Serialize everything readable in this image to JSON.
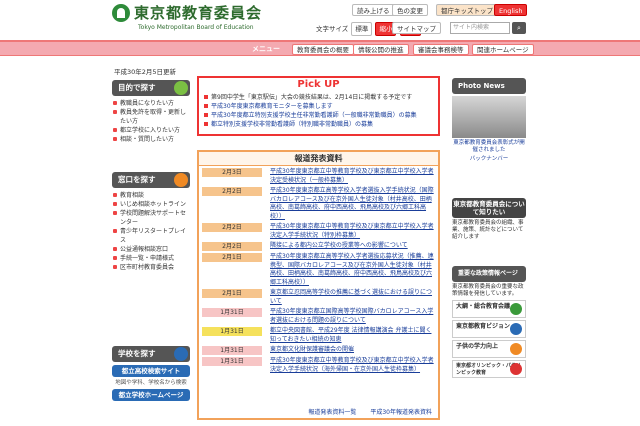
{
  "header": {
    "title": "東京都教育委員会",
    "subtitle": "Tokyo Metropolitan Board of Education",
    "read_aloud": "読み上げる",
    "color_change": "色の変更",
    "kids_top": "都庁キッズトップ",
    "english": "English",
    "text_size_label": "文字サイズ",
    "text_size_options": [
      "標準",
      "縮小",
      "拡大"
    ],
    "sitemap": "サイトマップ",
    "search_placeholder": "サイト内検索",
    "search_button": "検索"
  },
  "nav": {
    "menu_label": "メニュー",
    "items": [
      "教育委員会の概要",
      "情報公開の推進",
      "審議会事務検等",
      "関連ホームページ"
    ]
  },
  "date": "平成30年2月5日更新",
  "sidebar": {
    "purpose_head": "目的で探す",
    "purpose_items": [
      "教職員になりたい方",
      "教員免許を取得・更新したい方",
      "都立学校に入りたい方",
      "相談・質問したい方"
    ],
    "window_head": "窓口を探す",
    "window_items": [
      "教育相談",
      "いじめ相談ホットライン",
      "学校問題解決サポートセンター",
      "青少年リスタートプレイス",
      "公益通報相談窓口",
      "手続一覧・申請様式",
      "区市町村教育委員会"
    ],
    "school_head": "学校を探す",
    "school_banner1": "都立高校検索サイト",
    "school_note1": "地図や学科、学校名から検索",
    "school_banner2": "都立学校ホームページ"
  },
  "pickup": {
    "title": "Pick UP",
    "items": [
      "第9回中学生「東京駅伝」大会の競技結果は、2月14日に掲載する予定です",
      "平成30年度東京都教育モニターを募集します",
      "平成30年度都立特別支援学校主任非常勤看護師（一般職非常勤職員）の募集",
      "都立特別支援学校非常勤看護師（特別職非常勤職員）の募集"
    ]
  },
  "press": {
    "title": "報道発表資料",
    "rows": [
      {
        "date": "2月3日",
        "text": "平成30年度東京都立中等教育学校及び東京都立中学校入学者決定受検状況（一般枠募集）",
        "kind": "orange"
      },
      {
        "date": "2月2日",
        "text": "平成30年度東京都立高等学校入学者選抜入学手続状況（国際バカロレアコース及び在京外国人生徒対象（村井高校、田柄高校、南葛飾高校、府中西高校、飛鳥高校及び六郷工科高校））",
        "kind": "orange"
      },
      {
        "date": "2月2日",
        "text": "平成30年度東京都立中等教育学校及び東京都立中学校入学者決定入学手続状況（特別枠募集）",
        "kind": "orange"
      },
      {
        "date": "2月2日",
        "text": "隣接による都内公立学校の授業等への影響について",
        "kind": "orange"
      },
      {
        "date": "2月1日",
        "text": "平成30年度東京都立高等学校入学者選抜応募状況（推薦、連携型、国際バカロレアコース及び在京外国人生徒対象（村井高校、田柄高校、南葛飾高校、府中西高校、飛鳥高校及び六郷工科高校））",
        "kind": "orange"
      },
      {
        "date": "2月1日",
        "text": "東京都立忍岡高等学校の推薦に基づく選抜における誤りについて",
        "kind": "orange"
      },
      {
        "date": "1月31日",
        "text": "平成30年度東京都立国際高等学校国際バカロレアコース入学者選抜における問題の誤りについて",
        "kind": "pink"
      },
      {
        "date": "1月31日",
        "text": "都立中央図書館、平成29年度 法律情報講演会 弁護士に聞く 知っておきたい相続の知恵",
        "kind": "yel"
      },
      {
        "date": "1月31日",
        "text": "東京都文化財保護審議会の開催",
        "kind": "pink"
      },
      {
        "date": "1月31日",
        "text": "平成30年度東京都立中等教育学校及び東京都立中学校入学者決定入学手続状況（海外帰国・在京外国人生徒枠募集）",
        "kind": "pink"
      }
    ],
    "more1": "報道発表資料一覧",
    "more2": "平成30年報道発表資料"
  },
  "right": {
    "photo_head": "Photo News",
    "photo_caption": "東京都教育委員会表彰式が開催されました",
    "back_number": "バックナンバー",
    "about_head": "東京都教育委員会について知りたい",
    "about_text": "東京都教育委員会の組織、事業、施策、統計などについて紹介します",
    "policy_head": "重要な政策情報ページ",
    "policy_text": "東京都教育委員会の重要な政策情報を発信しています。",
    "banners": [
      "大綱・総合教育会議",
      "東京都教育ビジョン",
      "子供の学力向上",
      "東京都オリンピック・パラリンピック教育"
    ],
    "colors": {
      "green": "#3a9a3a",
      "blue": "#2a6bb5",
      "orange": "#f08a24",
      "red": "#d33"
    }
  }
}
